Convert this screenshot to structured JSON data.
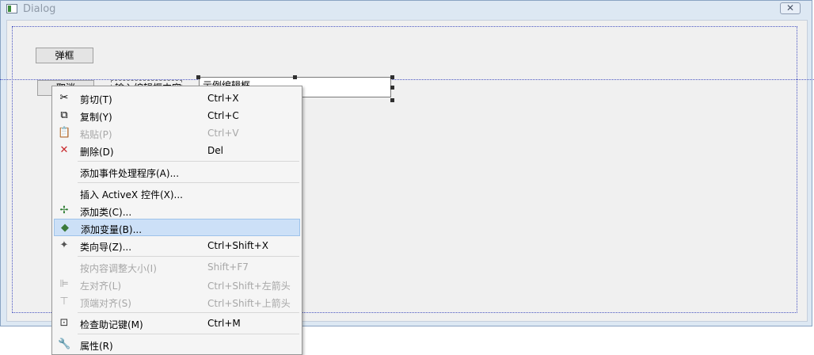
{
  "window": {
    "title": "Dialog",
    "close_glyph": "✕"
  },
  "dialog": {
    "popup_button_label": "弹框",
    "second_button_label": "取消",
    "static_label_text": "输入编辑框内容",
    "edit_value": "示例编辑框"
  },
  "menu": {
    "highlight_color": "#cce0f7",
    "items": [
      {
        "label": "剪切(T)",
        "shortcut": "Ctrl+X",
        "icon": "scissors-icon",
        "glyph": "✂",
        "enabled": true
      },
      {
        "label": "复制(Y)",
        "shortcut": "Ctrl+C",
        "icon": "copy-icon",
        "glyph": "⧉",
        "enabled": true
      },
      {
        "label": "粘贴(P)",
        "shortcut": "Ctrl+V",
        "icon": "paste-icon",
        "glyph": "📋",
        "enabled": false
      },
      {
        "label": "删除(D)",
        "shortcut": "Del",
        "icon": "delete-x-icon",
        "glyph": "✕",
        "enabled": true
      },
      {
        "label": "添加事件处理程序(A)...",
        "shortcut": "",
        "icon": "",
        "glyph": "",
        "enabled": true
      },
      {
        "label": "插入 ActiveX 控件(X)...",
        "shortcut": "",
        "icon": "",
        "glyph": "",
        "enabled": true
      },
      {
        "label": "添加类(C)...",
        "shortcut": "",
        "icon": "add-class-icon",
        "glyph": "✢",
        "enabled": true
      },
      {
        "label": "添加变量(B)...",
        "shortcut": "",
        "icon": "add-variable-icon",
        "glyph": "◆",
        "enabled": true,
        "highlighted": true
      },
      {
        "label": "类向导(Z)...",
        "shortcut": "Ctrl+Shift+X",
        "icon": "class-wizard-icon",
        "glyph": "✦",
        "enabled": true
      },
      {
        "label": "按内容调整大小(I)",
        "shortcut": "Shift+F7",
        "icon": "",
        "glyph": "",
        "enabled": false
      },
      {
        "label": "左对齐(L)",
        "shortcut": "Ctrl+Shift+左箭头",
        "icon": "align-left-icon",
        "glyph": "⊫",
        "enabled": false
      },
      {
        "label": "顶端对齐(S)",
        "shortcut": "Ctrl+Shift+上箭头",
        "icon": "align-top-icon",
        "glyph": "⊤",
        "enabled": false
      },
      {
        "label": "检查助记键(M)",
        "shortcut": "Ctrl+M",
        "icon": "check-mnemonic-icon",
        "glyph": "⊡",
        "enabled": true
      },
      {
        "label": "属性(R)",
        "shortcut": "",
        "icon": "wrench-icon",
        "glyph": "🔧",
        "enabled": true
      }
    ]
  }
}
